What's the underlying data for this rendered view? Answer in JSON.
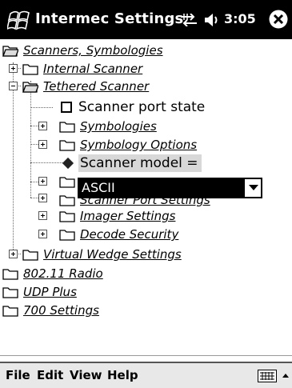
{
  "titlebar": {
    "title": "Intermec Settings",
    "time": "3:05",
    "icons": [
      "windows-start-icon",
      "connectivity-icon",
      "volume-icon",
      "close-icon"
    ]
  },
  "tree": {
    "root": "Scanners, Symbologies",
    "internal_scanner": "Internal Scanner",
    "tethered_scanner": "Tethered Scanner",
    "scanner_port_state": "Scanner port state",
    "symbologies": "Symbologies",
    "symbology_options": "Symbology Options",
    "scanner_model": "Scanner model =",
    "scanner_port_settings": "Scanner Port Settings",
    "imager_settings": "Imager Settings",
    "decode_security": "Decode Security",
    "virtual_wedge": "Virtual Wedge Settings",
    "radio": "802.11 Radio",
    "udp_plus": "UDP Plus",
    "settings_700": "700 Settings"
  },
  "combo": {
    "value": "ASCII"
  },
  "menubar": {
    "file": "File",
    "edit": "Edit",
    "view": "View",
    "help": "Help"
  }
}
